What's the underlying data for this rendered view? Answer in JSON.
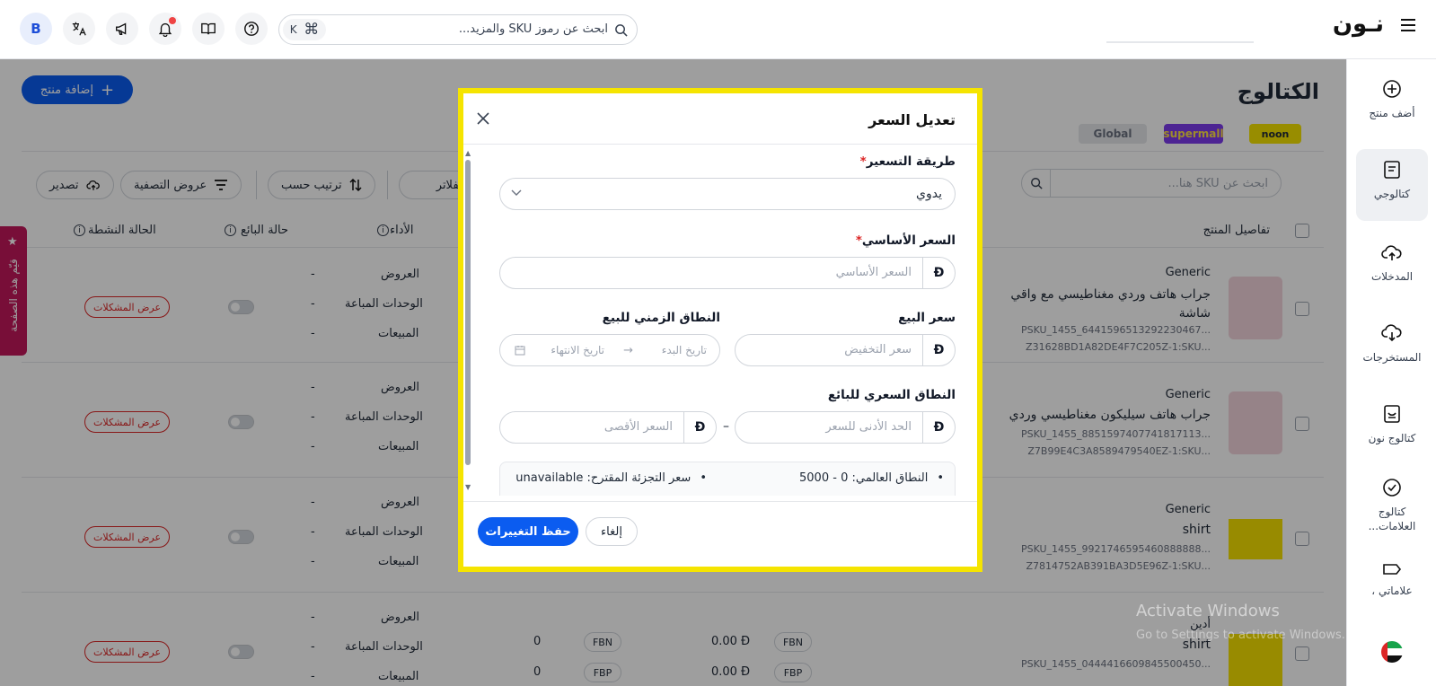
{
  "topbar": {
    "logo": "نـون",
    "search_placeholder": "ابحث عن رموز SKU والمزيد...",
    "shortcut_key": "K",
    "avatar_letter": "B",
    "notification_color": "#ef4444"
  },
  "sidebar": {
    "items": [
      {
        "label": "أضف منتج",
        "icon": "plus-circle-icon"
      },
      {
        "label": "كتالوجي",
        "icon": "catalog-icon"
      },
      {
        "label": "المدخلات",
        "icon": "cloud-upload-icon"
      },
      {
        "label": "المستخرجات",
        "icon": "cloud-download-icon"
      },
      {
        "label": "كتالوج نون",
        "icon": "noon-catalog-icon"
      },
      {
        "label": "كتالوج العلامات...",
        "icon": "verified-icon"
      },
      {
        "label": "علاماتي ،",
        "icon": "tag-icon"
      }
    ]
  },
  "page": {
    "title": "الكتالوج",
    "add_product_label": "إضافة منتج",
    "store_tabs": [
      "noon",
      "supermall",
      "Global"
    ],
    "sku_search_placeholder": "ابحث عن SKU هنا...",
    "toolbar": {
      "export": "تصدير",
      "filter_views": "عروض التصفية",
      "sort_by": "ترتيب حسب",
      "all_filters": "جميع الفلاتر"
    },
    "table_headers": {
      "product_details": "تفاصيل المنتج",
      "performance": "الأداء",
      "seller_status": "حالة البائع",
      "activity_status": "الحالة النشطة"
    },
    "feedback_tab": "قيّم هذه الصفحة",
    "rows": [
      {
        "brand": "Generic",
        "name": "جراب هاتف وردي مغناطيسي مع واقي شاشة",
        "psku": "PSKU_1455_6441596513292230467...",
        "sku": "Z31628BD1A82DE4F7C205Z-1:SKU...",
        "metrics": [
          "العروض",
          "الوحدات المباعة",
          "المبيعات"
        ],
        "values": [
          "-",
          "-",
          "-"
        ],
        "issues": "عرض المشكلات"
      },
      {
        "brand": "Generic",
        "name": "جراب هاتف سيليكون مغناطيسي وردي",
        "psku": "PSKU_1455_8851597407741817113...",
        "sku": "Z7B99E4C3A8589479540EZ-1:SKU...",
        "metrics": [
          "العروض",
          "الوحدات المباعة",
          "المبيعات"
        ],
        "values": [
          "-",
          "-",
          "-"
        ],
        "issues": "عرض المشكلات"
      },
      {
        "brand": "Generic",
        "name": "shirt",
        "psku": "PSKU_1455_9921746595460888888...",
        "sku": "Z7814752AB391BA3D5E96Z-1:SKU...",
        "metrics": [
          "العروض",
          "الوحدات المباعة",
          "المبيعات"
        ],
        "values": [
          "-",
          "-",
          "-"
        ],
        "issues": "عرض المشكلات"
      },
      {
        "brand": "أدين",
        "name": "shirt",
        "psku": "PSKU_1455_0444416609845500450...",
        "sku": "",
        "metrics": [
          "العروض",
          "الوحدات المباعة",
          "المبيعات"
        ],
        "values": [
          "-",
          "-",
          "-"
        ],
        "issues": "عرض المشكلات",
        "fulfilment": [
          {
            "type": "FBN",
            "price": "0.00",
            "qty": "0"
          },
          {
            "type": "FBP",
            "price": "0.00",
            "qty": "0"
          }
        ]
      }
    ]
  },
  "modal": {
    "title": "تعديل السعر",
    "pricing_method_label": "طريقة التسعير",
    "pricing_method_value": "يدوي",
    "base_price_label": "السعر الأساسي",
    "base_price_placeholder": "السعر الأساسي",
    "sale_price_label": "سعر البيع",
    "sale_price_placeholder": "سعر التخفيض",
    "sale_period_label": "النطاق الزمني للبيع",
    "start_date_placeholder": "تاريخ البدء",
    "end_date_placeholder": "تاريخ الانتهاء",
    "seller_range_label": "النطاق السعري للبائع",
    "min_price_placeholder": "الحد الأدنى للسعر",
    "max_price_placeholder": "السعر الأقصى",
    "range_separator": "–",
    "global_range_info": "النطاق العالمي: 0 - 5000",
    "suggested_retail_info": "سعر التجزئة المقترح: unavailable",
    "currency_symbol": "Ð",
    "required_mark": "*",
    "cancel_label": "إلغاء",
    "save_label": "حفظ التغييرات",
    "highlight_color": "#f5e400",
    "primary_color": "#0b5cf0"
  },
  "watermark": {
    "line1": "Activate Windows",
    "line2": "Go to Settings to activate Windows."
  }
}
